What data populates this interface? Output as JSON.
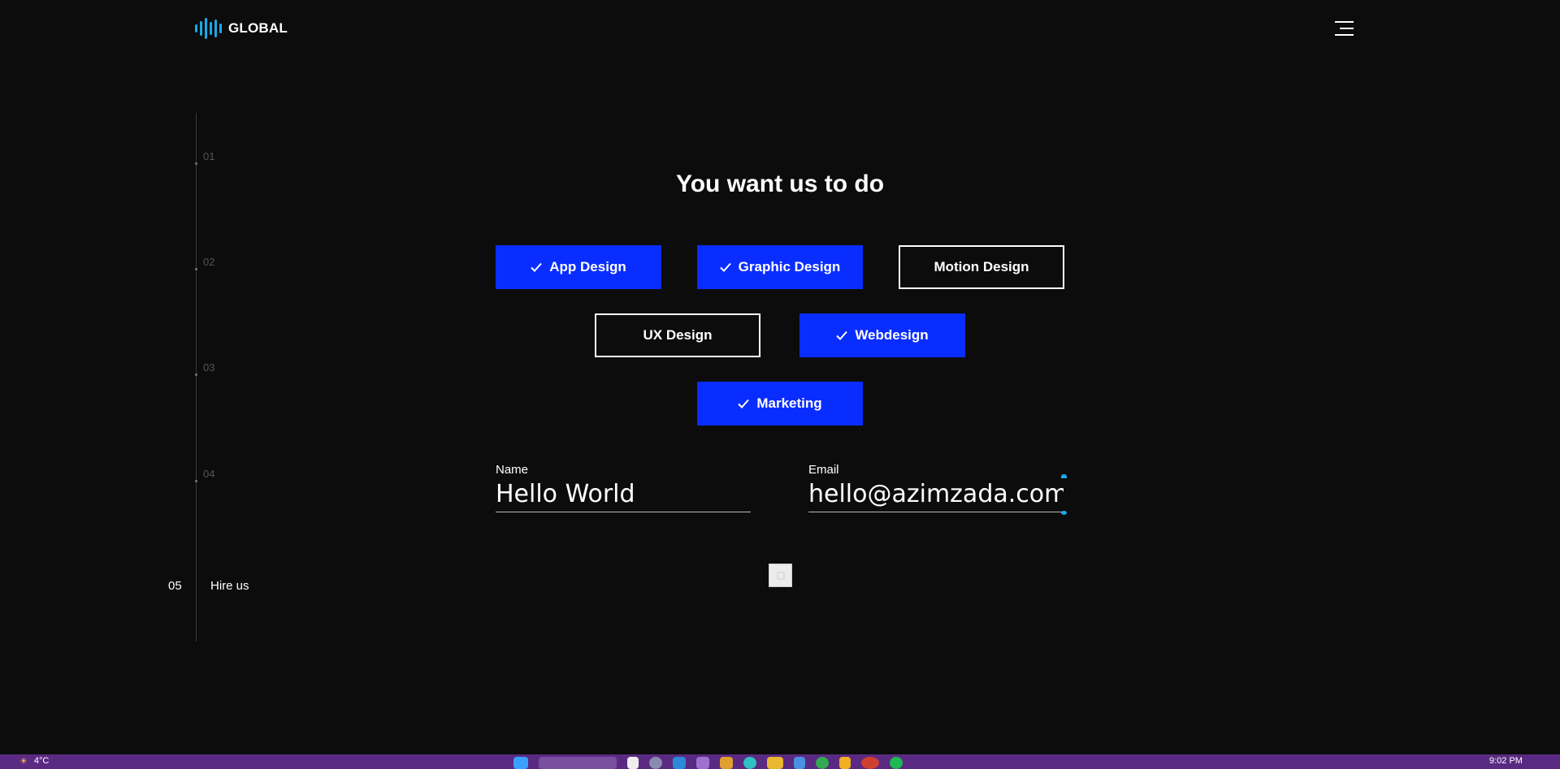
{
  "header": {
    "logo_text": "GLOBAL",
    "menu_icon": "hamburger-icon"
  },
  "steps": [
    {
      "number": "01"
    },
    {
      "number": "02"
    },
    {
      "number": "03"
    },
    {
      "number": "04"
    }
  ],
  "active_step": {
    "number": "05",
    "label": "Hire us"
  },
  "main": {
    "title": "You want us to do",
    "options": [
      {
        "label": "App Design",
        "selected": true
      },
      {
        "label": "Graphic Design",
        "selected": true
      },
      {
        "label": "Motion Design",
        "selected": false
      },
      {
        "label": "UX Design",
        "selected": false
      },
      {
        "label": "Webdesign",
        "selected": true
      },
      {
        "label": "Marketing",
        "selected": true
      }
    ],
    "name_field": {
      "label": "Name",
      "value": "Hello World"
    },
    "email_field": {
      "label": "Email",
      "value": "hello@azimzada.com"
    }
  },
  "taskbar": {
    "temperature": "4°C",
    "time": "9:02 PM"
  },
  "colors": {
    "accent": "#0a2dff",
    "logo": "#1aa8e8",
    "background": "#0c0c0c",
    "taskbar": "#5a2a82"
  }
}
